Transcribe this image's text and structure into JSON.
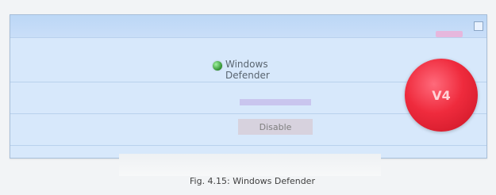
{
  "window": {
    "title": "",
    "corner_button": ""
  },
  "list_item": {
    "line1": "Windows",
    "line2": "Defender"
  },
  "action_button": "Disable",
  "badge": {
    "text": "V4"
  },
  "caption": "Fig. 4.15: Windows Defender",
  "colors": {
    "panel": "#d7e8fb",
    "badge": "#ef2b3d",
    "status_ok": "#2f8f2f",
    "highlight": "#c9c5ee"
  }
}
